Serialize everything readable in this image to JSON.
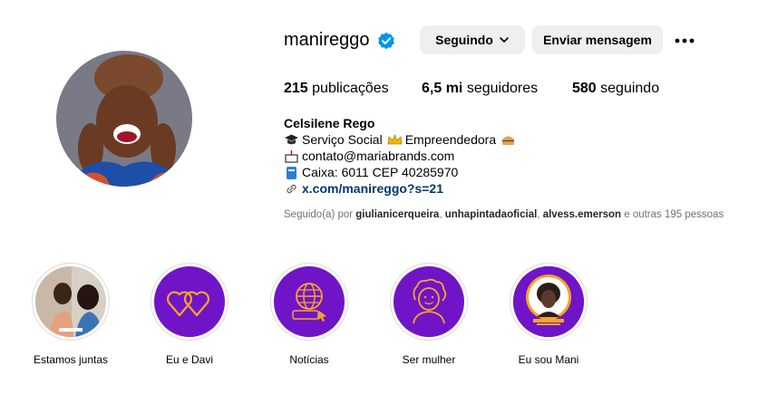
{
  "profile": {
    "username": "manireggo",
    "follow_button_label": "Seguindo",
    "message_button_label": "Enviar mensagem",
    "stats": [
      {
        "count": "215",
        "label": "publicações"
      },
      {
        "count": "6,5 mi",
        "label": "seguidores"
      },
      {
        "count": "580",
        "label": "seguindo"
      }
    ],
    "bio": {
      "name": "Celsilene Rego",
      "line1_a": "Serviço Social",
      "line1_b": "Empreendedora",
      "line2": "contato@mariabrands.com",
      "line3": "Caixa: 6011 CEP 40285970",
      "link": "x.com/manireggo?s=21"
    },
    "followed_by": {
      "prefix": "Seguido(a) por",
      "users": [
        "giulianicerqueira",
        "unhapintadaoficial",
        "alvess.emerson"
      ],
      "sep": ",",
      "suffix": "e outras 195 pessoas"
    }
  },
  "highlights": [
    {
      "label": "Estamos juntas",
      "icon": "photo-thumbnail"
    },
    {
      "label": "Eu e Davi",
      "icon": "hearts-icon"
    },
    {
      "label": "Notícias",
      "icon": "globe-www-icon"
    },
    {
      "label": "Ser mulher",
      "icon": "woman-face-icon"
    },
    {
      "label": "Eu sou Mani",
      "icon": "portrait-thumbnail"
    }
  ],
  "colors": {
    "verified": "#0095f6",
    "highlight_bg": "#7014c8",
    "highlight_line": "#f5a623",
    "link": "#00376b",
    "button_bg": "#efefef"
  }
}
